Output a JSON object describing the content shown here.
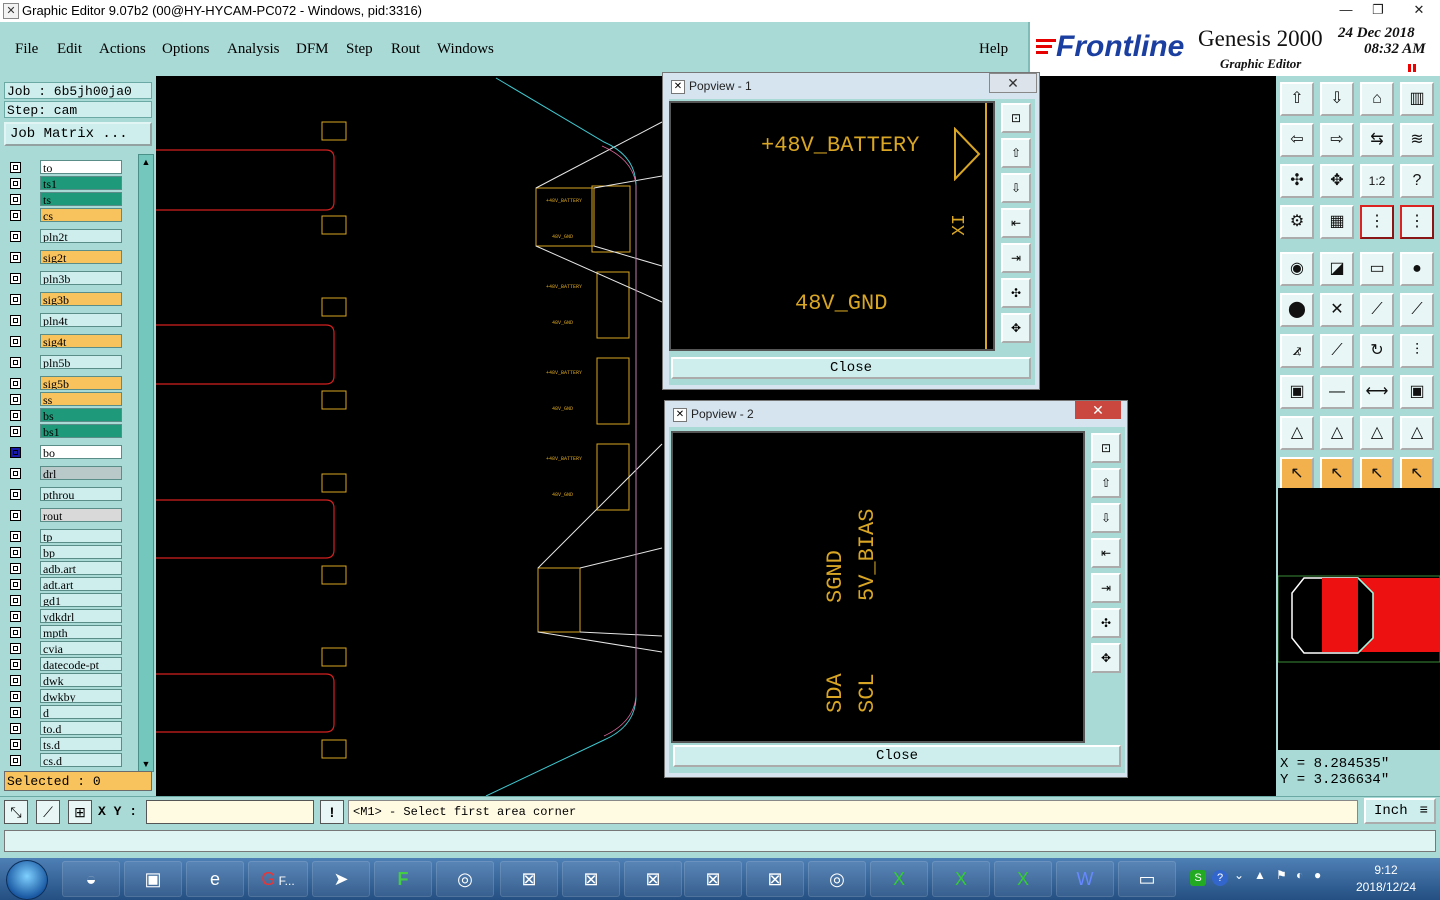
{
  "window": {
    "title": "Graphic Editor 9.07b2 (00@HY-HYCAM-PC072 - Windows, pid:3316)"
  },
  "menu": [
    "File",
    "Edit",
    "Actions",
    "Options",
    "Analysis",
    "DFM",
    "Step",
    "Rout",
    "Windows"
  ],
  "help_label": "Help",
  "brand": {
    "logo": "Frontline",
    "product": "Genesis 2000",
    "subtitle": "Graphic Editor",
    "date": "24 Dec 2018",
    "time": "08:32 AM"
  },
  "job": {
    "job_line": "Job : 6b5jh00ja0",
    "step_line": "Step: cam",
    "matrix_button": "Job Matrix ..."
  },
  "layers": [
    {
      "name": "to",
      "color": "#ffffff"
    },
    {
      "name": "ts1",
      "color": "#1e9a7a"
    },
    {
      "name": "ts",
      "color": "#1e9a7a"
    },
    {
      "name": "cs",
      "color": "#f8c35c"
    },
    {
      "name": "pln2t",
      "color": "#cdeeed"
    },
    {
      "name": "sig2t",
      "color": "#f8c35c"
    },
    {
      "name": "pln3b",
      "color": "#cdeeed"
    },
    {
      "name": "sig3b",
      "color": "#f8c35c"
    },
    {
      "name": "pln4t",
      "color": "#cdeeed"
    },
    {
      "name": "sig4t",
      "color": "#f8c35c"
    },
    {
      "name": "pln5b",
      "color": "#cdeeed"
    },
    {
      "name": "sig5b",
      "color": "#f8c35c"
    },
    {
      "name": "ss",
      "color": "#f8c35c"
    },
    {
      "name": "bs",
      "color": "#1e9a7a"
    },
    {
      "name": "bs1",
      "color": "#1e9a7a"
    },
    {
      "name": "bo",
      "color": "#ffffff"
    },
    {
      "name": "drl",
      "color": "#b9c8c8"
    },
    {
      "name": "pthrou",
      "color": "#cdeeed"
    },
    {
      "name": "rout",
      "color": "#d9d9d9"
    },
    {
      "name": "tp",
      "color": "#cdeeed"
    },
    {
      "name": "bp",
      "color": "#cdeeed"
    },
    {
      "name": "adb.art",
      "color": "#cdeeed"
    },
    {
      "name": "adt.art",
      "color": "#cdeeed"
    },
    {
      "name": "gd1",
      "color": "#cdeeed"
    },
    {
      "name": "ydkdrl",
      "color": "#cdeeed"
    },
    {
      "name": "mpth",
      "color": "#cdeeed"
    },
    {
      "name": "cvia",
      "color": "#cdeeed"
    },
    {
      "name": "datecode-pt",
      "color": "#cdeeed"
    },
    {
      "name": "dwk",
      "color": "#cdeeed"
    },
    {
      "name": "dwkby",
      "color": "#cdeeed"
    },
    {
      "name": "d",
      "color": "#cdeeed"
    },
    {
      "name": "to.d",
      "color": "#cdeeed"
    },
    {
      "name": "ts.d",
      "color": "#cdeeed"
    },
    {
      "name": "cs.d",
      "color": "#cdeeed"
    }
  ],
  "selected_text": "Selected : 0",
  "coords": {
    "x": "X = 8.284535\"",
    "y": "Y = 3.236634\""
  },
  "bottom": {
    "xy_label": "X Y :",
    "message": "<M1> - Select first area corner",
    "unit": "Inch"
  },
  "popup1": {
    "title": "Popview - 1",
    "close_label": "Close",
    "texts": {
      "battery": "+48V_BATTERY",
      "gnd": "48V_GND",
      "xi": "XI"
    }
  },
  "popup2": {
    "title": "Popview - 2",
    "close_label": "Close",
    "texts": {
      "sgnd": "SGND",
      "bias": "5V_BIAS",
      "sda": "SDA",
      "scl": "SCL"
    }
  },
  "taskbar": {
    "active_label": "F...",
    "clock_time": "9:12",
    "clock_date": "2018/12/24"
  },
  "colors": {
    "panel": "#a9dad6",
    "trace_red": "#d42020",
    "silk_gold": "#d8a624",
    "accent_red": "#e60000"
  }
}
